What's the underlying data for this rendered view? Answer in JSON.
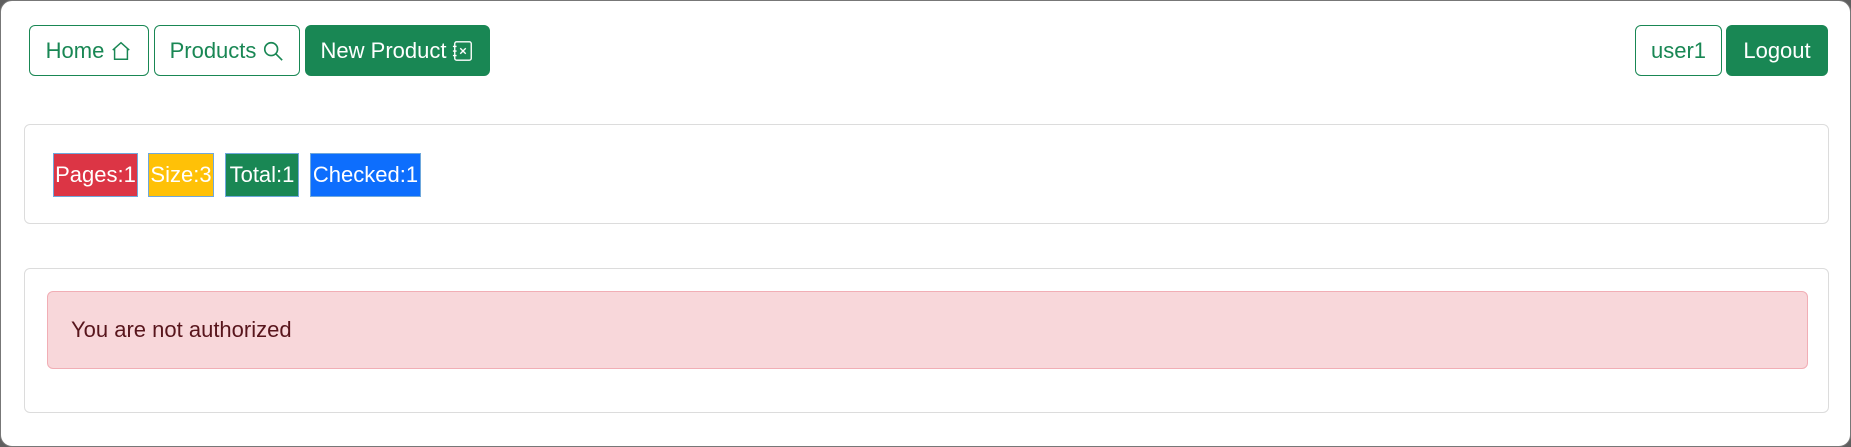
{
  "navbar": {
    "home_label": "Home",
    "home_icon": "house-icon",
    "products_label": "Products",
    "products_icon": "search-icon",
    "new_product_label": "New Product",
    "new_product_icon": "new-product-icon",
    "user_label": "user1",
    "logout_label": "Logout"
  },
  "stats": {
    "pages": "Pages:1",
    "size": "Size:3",
    "total": "Total:1",
    "checked": "Checked:1"
  },
  "alert": {
    "message": "You are not authorized"
  },
  "colors": {
    "primary_green": "#198754",
    "danger": "#dc3545",
    "warning": "#ffc107",
    "info_blue": "#0d6efd",
    "alert_bg": "#f8d7da",
    "alert_text": "#58151c"
  }
}
